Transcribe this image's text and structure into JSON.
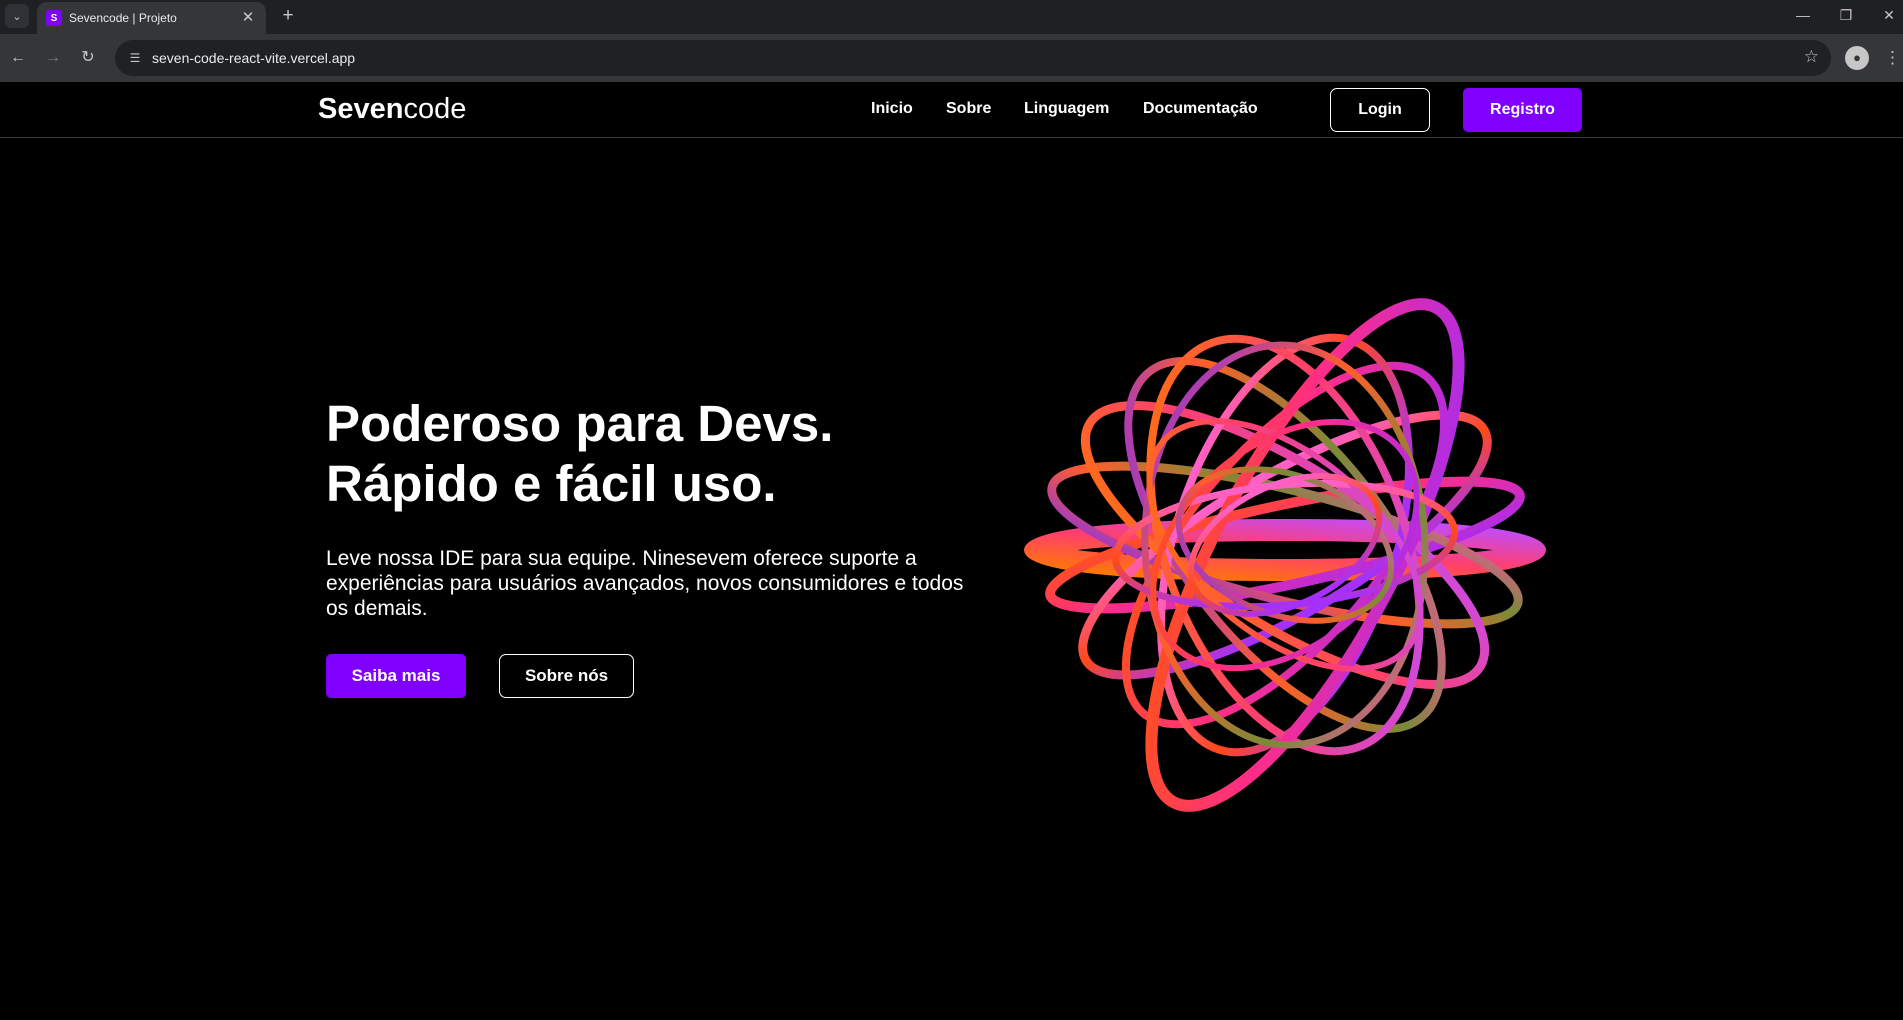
{
  "browser": {
    "tab_title": "Sevencode | Projeto",
    "favicon_letter": "S",
    "url": "seven-code-react-vite.vercel.app",
    "icons": {
      "tab_search": "chevron-down-icon",
      "tab_close": "close-icon",
      "new_tab": "plus-icon",
      "back": "arrow-left-icon",
      "forward": "arrow-right-icon",
      "reload": "reload-icon",
      "site_info": "tune-icon",
      "bookmark": "star-icon",
      "profile": "person-icon",
      "menu": "kebab-icon",
      "minimize": "minimize-icon",
      "maximize": "restore-icon",
      "close": "close-icon"
    }
  },
  "header": {
    "logo_bold": "Seven",
    "logo_light": "code",
    "nav": [
      "Inicio",
      "Sobre",
      "Linguagem",
      "Documentação"
    ],
    "login_label": "Login",
    "register_label": "Registro"
  },
  "hero": {
    "title_line1": "Poderoso para Devs.",
    "title_line2": "Rápido e fácil uso.",
    "description": "Leve nossa IDE para sua equipe. Ninesevem oferece suporte a experiências para usuários avançados, novos consumidores e todos os demais.",
    "primary_button": "Saiba mais",
    "secondary_button": "Sobre nós",
    "illustration": "abstract-ribbon-sphere"
  },
  "colors": {
    "accent": "#7f00ff",
    "background": "#000000",
    "text": "#ffffff",
    "chrome_dark": "#1f2023",
    "chrome_toolbar": "#35363a"
  }
}
